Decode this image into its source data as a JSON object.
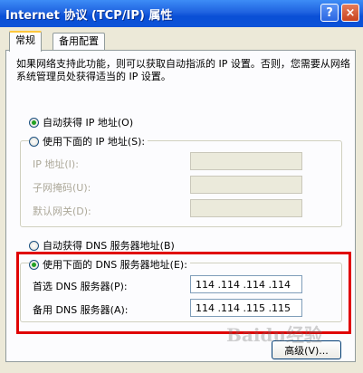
{
  "window": {
    "title": "Internet 协议 (TCP/IP) 属性",
    "help_label": "?",
    "close_label": "×"
  },
  "tabs": [
    {
      "label": "常规",
      "active": true
    },
    {
      "label": "备用配置",
      "active": false
    }
  ],
  "description": "如果网络支持此功能，则可以获取自动指派的 IP 设置。否则，您需要从网络系统管理员处获得适当的 IP 设置。",
  "ip_section": {
    "auto_label": "自动获得 IP 地址(O)",
    "manual_label": "使用下面的 IP 地址(S):",
    "selected": "auto",
    "fields": [
      {
        "label": "IP 地址(I):",
        "value": ""
      },
      {
        "label": "子网掩码(U):",
        "value": ""
      },
      {
        "label": "默认网关(D):",
        "value": ""
      }
    ]
  },
  "dns_section": {
    "auto_label": "自动获得 DNS 服务器地址(B)",
    "manual_label": "使用下面的 DNS 服务器地址(E):",
    "selected": "manual",
    "preferred_label": "首选 DNS 服务器(P):",
    "preferred_value": "114 .114 .114 .114",
    "alternate_label": "备用 DNS 服务器(A):",
    "alternate_value": "114 .114 .115 .115"
  },
  "buttons": {
    "advanced_label": "高级(V)..."
  },
  "watermark": "Baidu经验",
  "colors": {
    "titlebar": "#0a4fd6",
    "highlight": "#e00000",
    "dialog_bg": "#ece9d8"
  }
}
